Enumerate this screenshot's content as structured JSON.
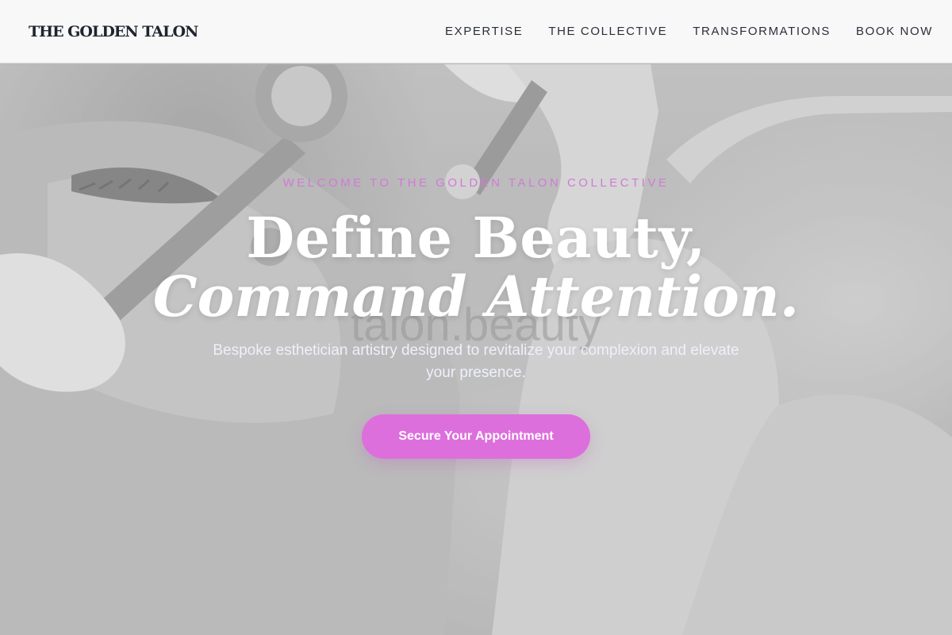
{
  "brand": {
    "name": "THE GOLDEN TALON"
  },
  "nav": {
    "items": [
      {
        "label": "EXPERTISE"
      },
      {
        "label": "THE COLLECTIVE"
      },
      {
        "label": "TRANSFORMATIONS"
      },
      {
        "label": "BOOK NOW"
      }
    ]
  },
  "hero": {
    "eyebrow": "WELCOME TO THE GOLDEN TALON COLLECTIVE",
    "headline_line1": "Define Beauty,",
    "headline_line2": "Command Attention.",
    "watermark": "talon.beauty",
    "subtext": "Bespoke esthetician artistry designed to revitalize your complexion and elevate your presence.",
    "cta_label": "Secure Your Appointment",
    "background_image": "grayscale-facial-treatment-photo"
  },
  "colors": {
    "accent": "#dd6fdc",
    "eyebrow": "#d27ad6",
    "header_bg": "#f8f8f8",
    "nav_text": "#2a2f3a"
  }
}
